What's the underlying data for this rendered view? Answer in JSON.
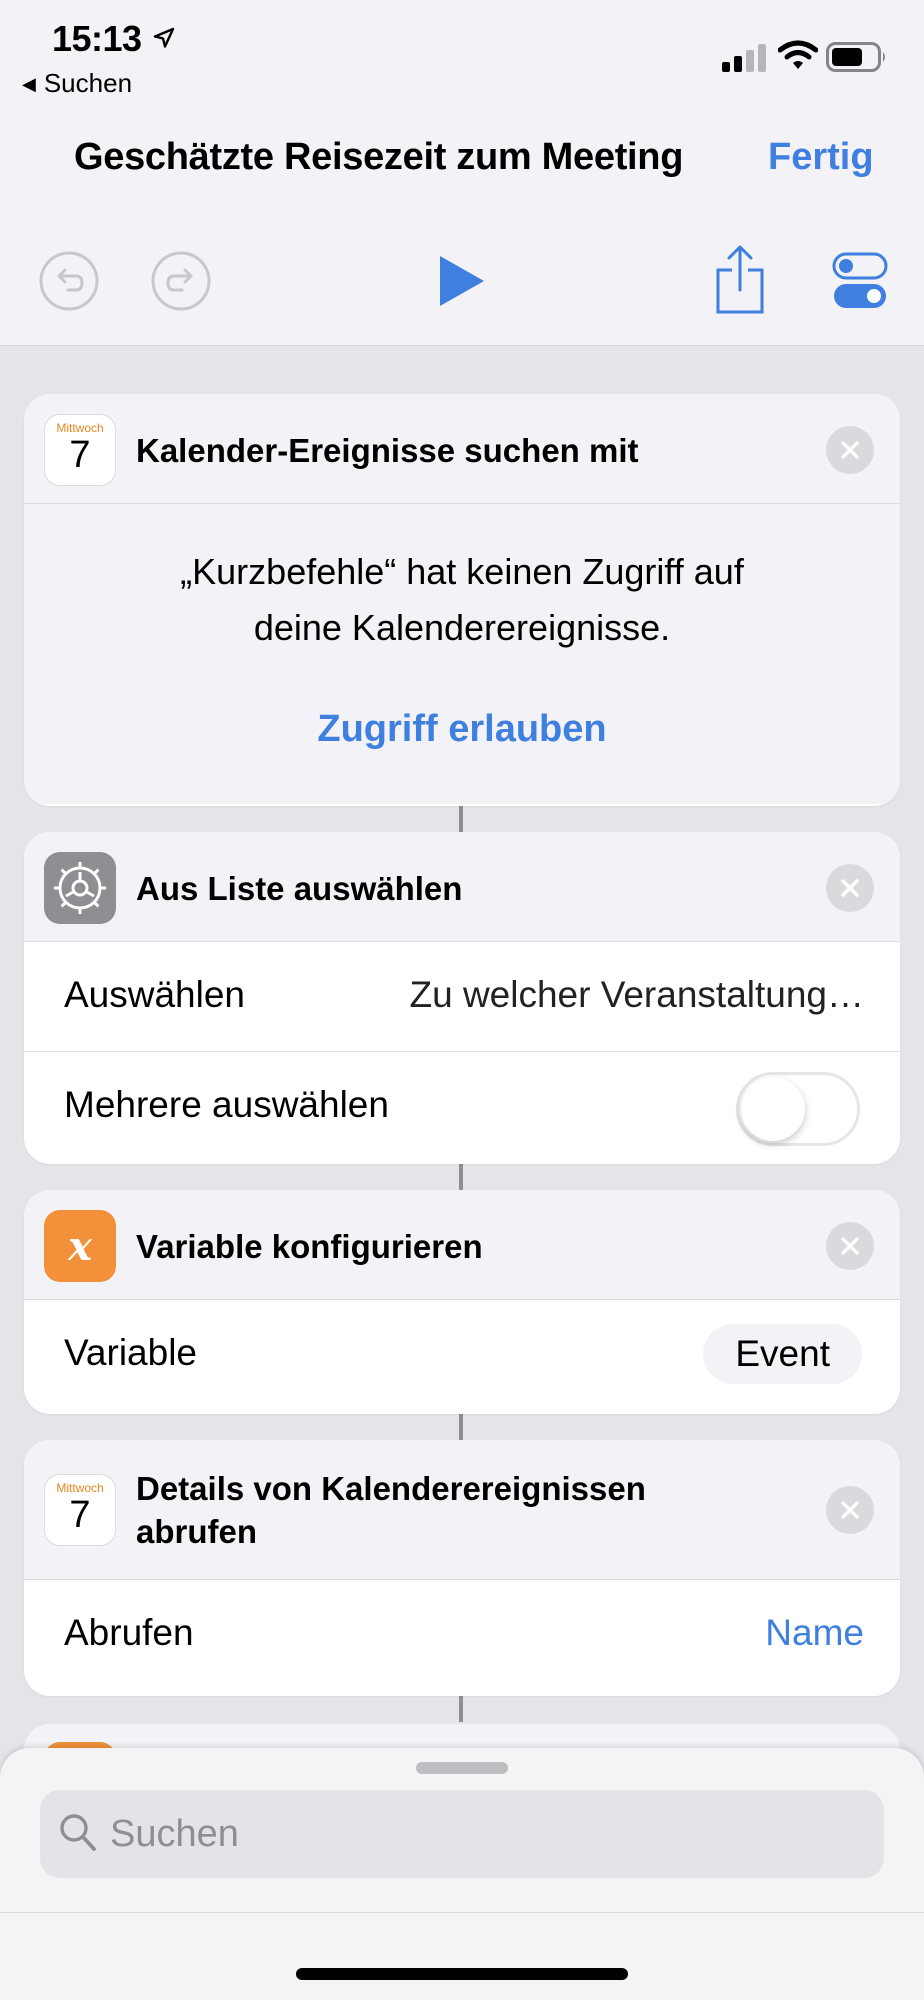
{
  "status_bar": {
    "time": "15:13",
    "back_label": "Suchen"
  },
  "nav": {
    "title": "Geschätzte Reisezeit zum Meeting",
    "done_label": "Fertig"
  },
  "colors": {
    "accent": "#3f7fe0",
    "variable_icon": "#f2913a",
    "settings_icon": "#8e8e93"
  },
  "actions": [
    {
      "icon": "calendar-icon",
      "calendar_weekday": "Mittwoch",
      "calendar_day": "7",
      "title": "Kalender-Ereignisse suchen mit",
      "message_line1": "„Kurzbefehle“ hat keinen Zugriff auf",
      "message_line2": "deine Kalenderereignisse.",
      "link": "Zugriff erlauben"
    },
    {
      "icon": "gear-icon",
      "title": "Aus Liste auswählen",
      "rows": [
        {
          "label": "Auswählen",
          "value": "Zu welcher Veranstaltung…"
        },
        {
          "label": "Mehrere auswählen",
          "toggle": false
        }
      ]
    },
    {
      "icon": "variable-icon",
      "icon_glyph": "x",
      "title": "Variable konfigurieren",
      "rows": [
        {
          "label": "Variable",
          "value": "Event"
        }
      ]
    },
    {
      "icon": "calendar-icon",
      "calendar_weekday": "Mittwoch",
      "calendar_day": "7",
      "title": "Details von Kalenderereignissen abrufen",
      "rows": [
        {
          "label": "Abrufen",
          "value": "Name"
        }
      ]
    }
  ],
  "search": {
    "placeholder": "Suchen",
    "value": ""
  }
}
